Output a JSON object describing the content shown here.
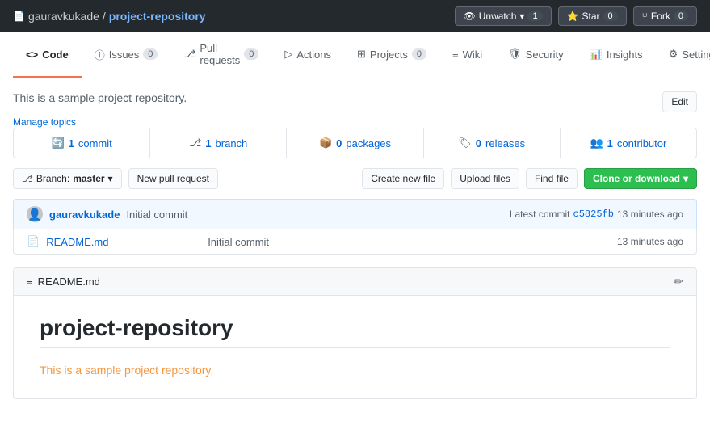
{
  "header": {
    "owner": "gauravkukade",
    "separator": "/",
    "repo_name": "project-repository",
    "watch_label": "Unwatch",
    "watch_count": "1",
    "star_label": "Star",
    "star_count": "0",
    "fork_label": "Fork",
    "fork_count": "0"
  },
  "nav": {
    "tabs": [
      {
        "id": "code",
        "label": "Code",
        "count": null,
        "active": true
      },
      {
        "id": "issues",
        "label": "Issues",
        "count": "0",
        "active": false
      },
      {
        "id": "pull-requests",
        "label": "Pull requests",
        "count": "0",
        "active": false
      },
      {
        "id": "actions",
        "label": "Actions",
        "count": null,
        "active": false
      },
      {
        "id": "projects",
        "label": "Projects",
        "count": "0",
        "active": false
      },
      {
        "id": "wiki",
        "label": "Wiki",
        "count": null,
        "active": false
      },
      {
        "id": "security",
        "label": "Security",
        "count": null,
        "active": false
      },
      {
        "id": "insights",
        "label": "Insights",
        "count": null,
        "active": false
      },
      {
        "id": "settings",
        "label": "Settings",
        "count": null,
        "active": false
      }
    ]
  },
  "repo": {
    "description": "This is a sample project repository.",
    "manage_topics": "Manage topics",
    "edit_label": "Edit"
  },
  "stats": [
    {
      "icon": "commit-icon",
      "value": "1",
      "label": "commit"
    },
    {
      "icon": "branch-icon",
      "value": "1",
      "label": "branch"
    },
    {
      "icon": "package-icon",
      "value": "0",
      "label": "packages"
    },
    {
      "icon": "release-icon",
      "value": "0",
      "label": "releases"
    },
    {
      "icon": "contributor-icon",
      "value": "1",
      "label": "contributor"
    }
  ],
  "toolbar": {
    "branch_label": "Branch:",
    "branch_name": "master",
    "new_pr_label": "New pull request",
    "create_file_label": "Create new file",
    "upload_files_label": "Upload files",
    "find_file_label": "Find file",
    "clone_label": "Clone or download"
  },
  "commit_bar": {
    "author": "gauravkukade",
    "message": "Initial commit",
    "latest_label": "Latest commit",
    "hash": "c5825fb",
    "time": "13 minutes ago"
  },
  "files": [
    {
      "icon": "file-icon",
      "name": "README.md",
      "commit_msg": "Initial commit",
      "time": "13 minutes ago"
    }
  ],
  "readme": {
    "title": "README.md",
    "edit_icon": "pencil-icon",
    "heading": "project-repository",
    "body": "This is a sample project repository."
  }
}
